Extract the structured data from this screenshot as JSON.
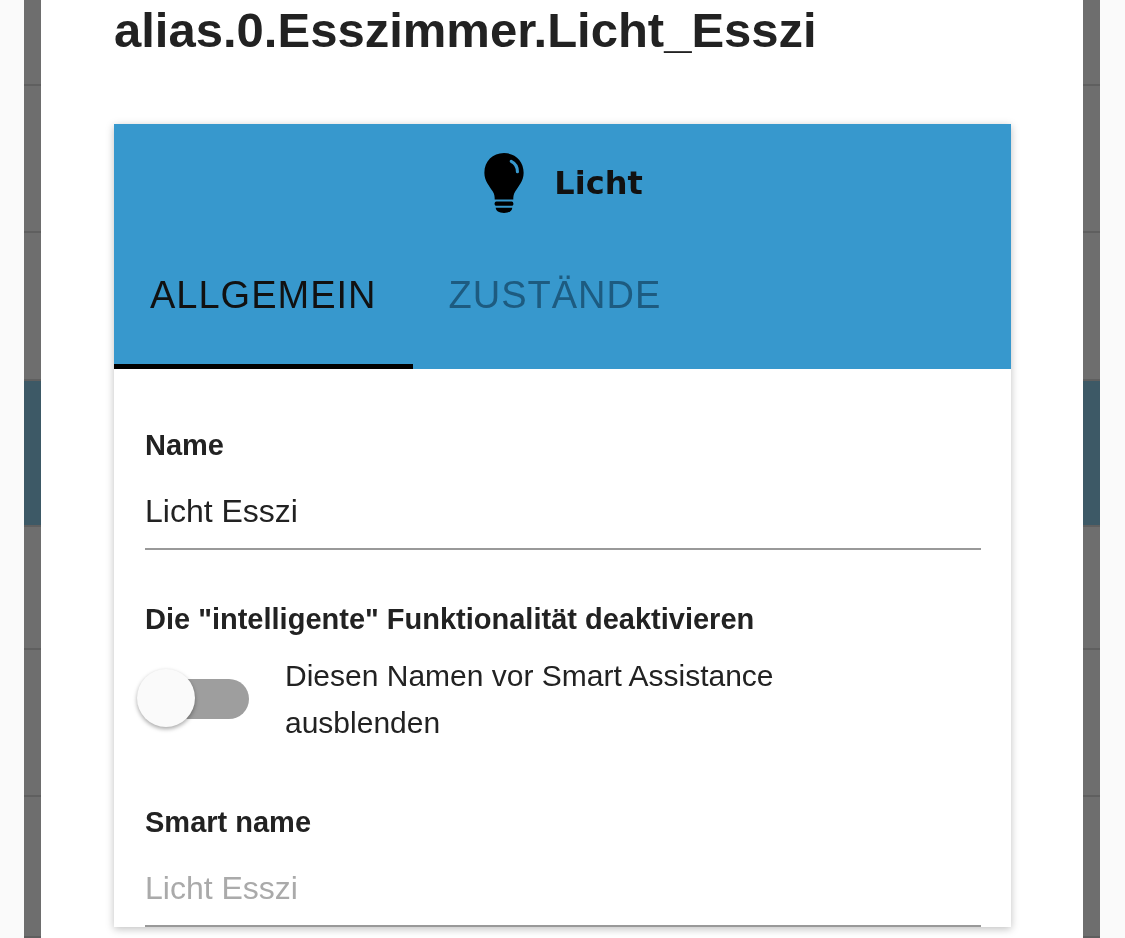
{
  "dialog": {
    "title": "alias.0.Esszimmer.Licht_Esszi"
  },
  "card": {
    "type_label": "Licht",
    "tabs": [
      {
        "label": "ALLGEMEIN",
        "selected": true
      },
      {
        "label": "ZUSTÄNDE",
        "selected": false
      }
    ],
    "fields": [
      {
        "kind": "text",
        "label": "Name",
        "value": "Licht Esszi"
      },
      {
        "kind": "switch",
        "label": "Die \"intelligente\" Funktionalität deaktivieren",
        "on": false,
        "text": "Diesen Namen vor Smart Assistance ausblenden"
      },
      {
        "kind": "text",
        "label": "Smart name",
        "placeholder": "Licht Esszi"
      }
    ]
  }
}
